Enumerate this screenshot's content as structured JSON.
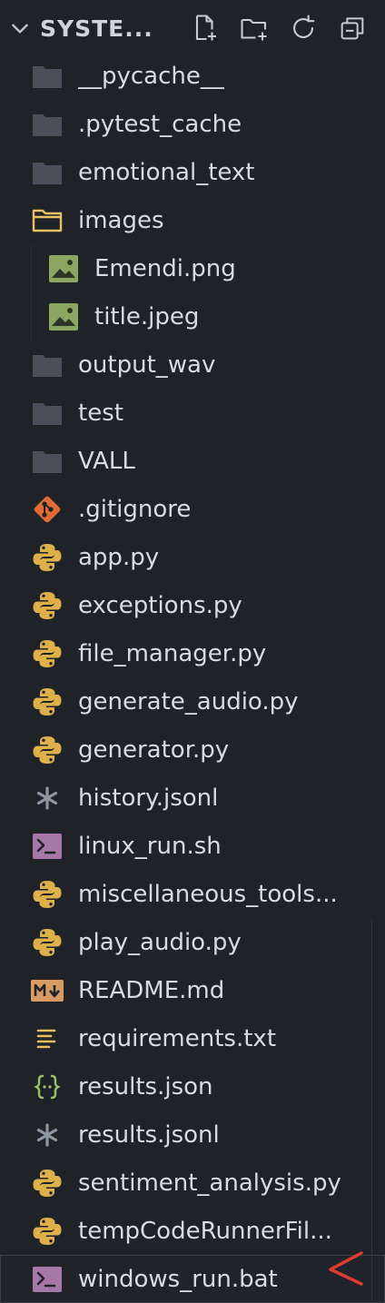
{
  "explorer": {
    "section_title": "SYSTE...",
    "chevron_icon": "chevron-down-icon",
    "actions": [
      {
        "name": "new-file-icon"
      },
      {
        "name": "new-folder-icon"
      },
      {
        "name": "refresh-icon"
      },
      {
        "name": "collapse-all-icon"
      }
    ]
  },
  "tree": {
    "items": [
      {
        "label": "__pycache__",
        "type": "folder"
      },
      {
        "label": ".pytest_cache",
        "type": "folder"
      },
      {
        "label": "emotional_text",
        "type": "folder"
      },
      {
        "label": "images",
        "type": "folder-open"
      },
      {
        "label": "Emendi.png",
        "type": "image",
        "indent": 1
      },
      {
        "label": "title.jpeg",
        "type": "image",
        "indent": 1
      },
      {
        "label": "output_wav",
        "type": "folder"
      },
      {
        "label": "test",
        "type": "folder"
      },
      {
        "label": "VALL",
        "type": "folder"
      },
      {
        "label": ".gitignore",
        "type": "git"
      },
      {
        "label": "app.py",
        "type": "python"
      },
      {
        "label": "exceptions.py",
        "type": "python"
      },
      {
        "label": "file_manager.py",
        "type": "python"
      },
      {
        "label": "generate_audio.py",
        "type": "python"
      },
      {
        "label": "generator.py",
        "type": "python"
      },
      {
        "label": "history.jsonl",
        "type": "asterisk"
      },
      {
        "label": "linux_run.sh",
        "type": "shell"
      },
      {
        "label": "miscellaneous_tools...",
        "type": "python"
      },
      {
        "label": "play_audio.py",
        "type": "python"
      },
      {
        "label": "README.md",
        "type": "markdown"
      },
      {
        "label": "requirements.txt",
        "type": "text"
      },
      {
        "label": "results.json",
        "type": "json"
      },
      {
        "label": "results.jsonl",
        "type": "asterisk"
      },
      {
        "label": "sentiment_analysis.py",
        "type": "python"
      },
      {
        "label": "tempCodeRunnerFil...",
        "type": "python"
      },
      {
        "label": "windows_run.bat",
        "type": "shell",
        "selected": true
      }
    ]
  },
  "annotation": {
    "marker_icon": "red-arrow-marker-icon",
    "color": "#e03a2f"
  }
}
